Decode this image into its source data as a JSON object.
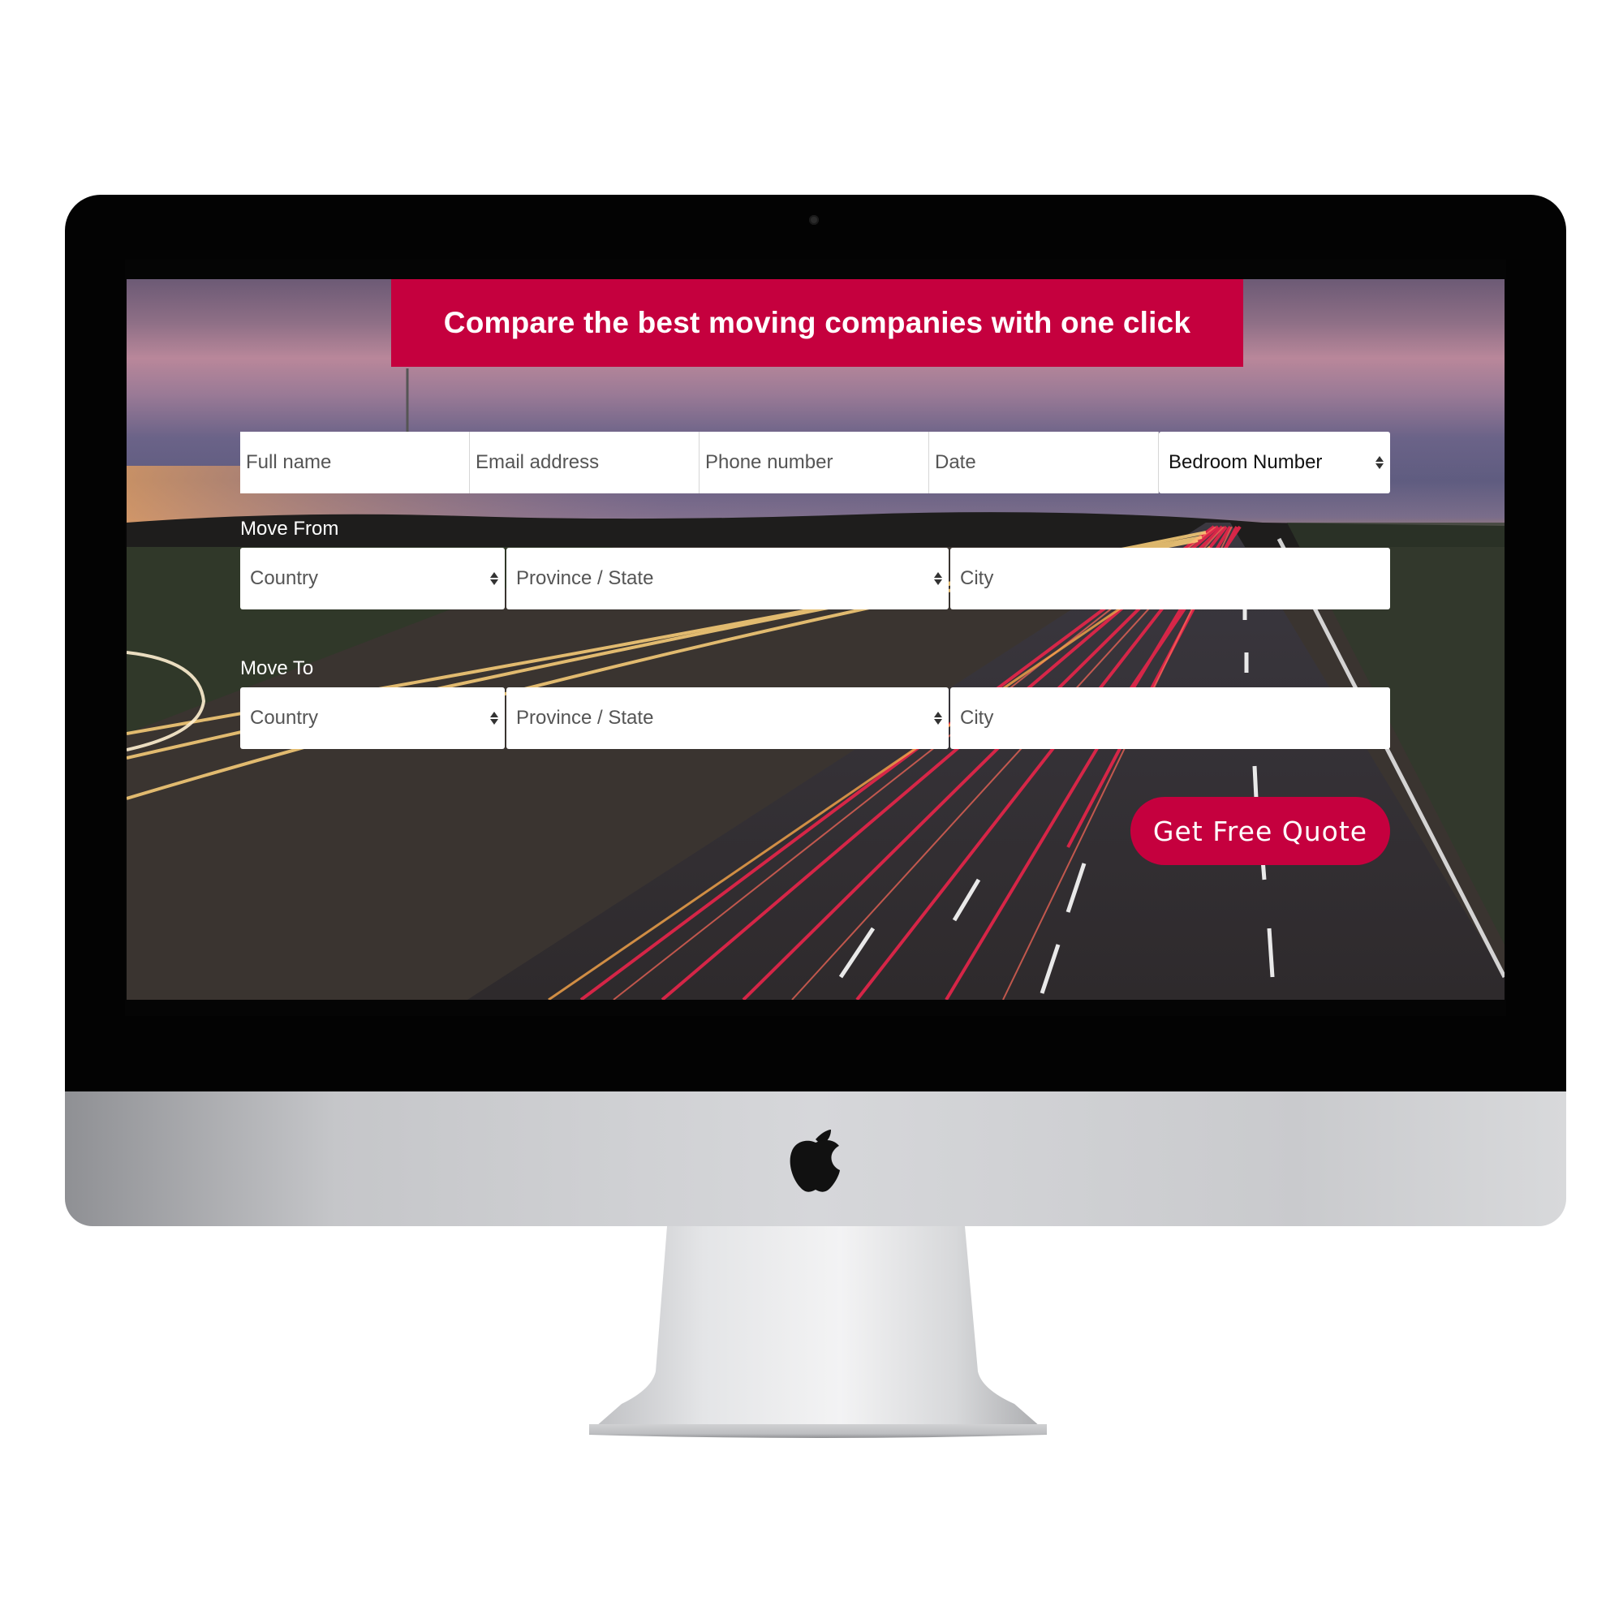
{
  "banner": {
    "title": "Compare the best moving companies with one click"
  },
  "contact_row": {
    "full_name_placeholder": "Full name",
    "email_placeholder": "Email address",
    "phone_placeholder": "Phone number",
    "date_placeholder": "Date",
    "bedroom_select": "Bedroom Number"
  },
  "move_from": {
    "label": "Move From",
    "country": "Country",
    "province": "Province / State",
    "city_placeholder": "City"
  },
  "move_to": {
    "label": "Move To",
    "country": "Country",
    "province": "Province / State",
    "city_placeholder": "City"
  },
  "cta": {
    "label": "Get Free Quote"
  },
  "colors": {
    "brand_red": "#c5003e",
    "bezel": "#030303",
    "chin_silver": "#d6d7da"
  },
  "icons": {
    "device": "apple-logo-icon",
    "select_arrows": "up-down-arrows-icon",
    "camera": "webcam-icon"
  }
}
